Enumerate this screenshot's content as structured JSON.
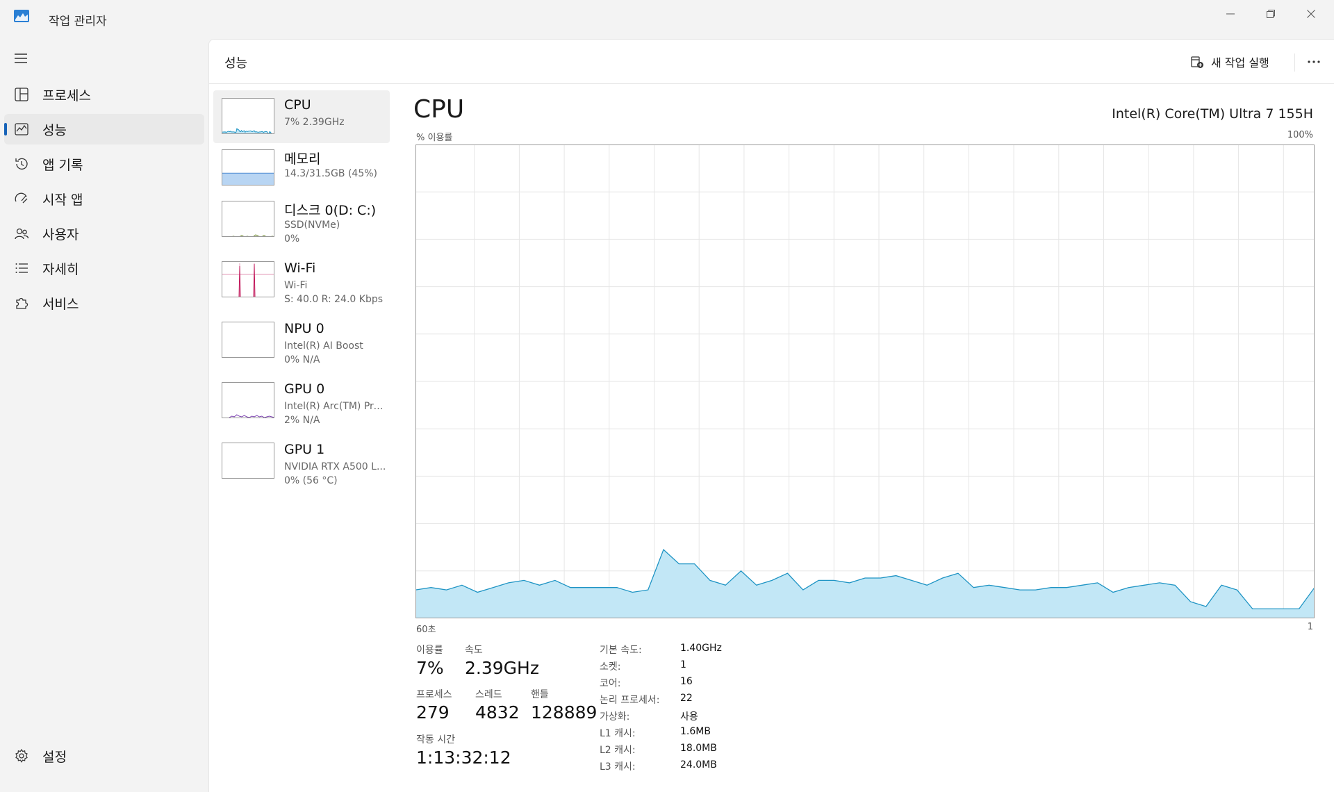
{
  "app": {
    "title": "작업 관리자"
  },
  "sidebar": {
    "items": [
      {
        "label": "프로세스"
      },
      {
        "label": "성능"
      },
      {
        "label": "앱 기록"
      },
      {
        "label": "시작 앱"
      },
      {
        "label": "사용자"
      },
      {
        "label": "자세히"
      },
      {
        "label": "서비스"
      }
    ],
    "settings_label": "설정"
  },
  "header": {
    "page_title": "성능",
    "run_task_label": "새 작업 실행"
  },
  "devices": [
    {
      "name": "CPU",
      "sub1": "7% 2.39GHz",
      "sub2": ""
    },
    {
      "name": "메모리",
      "sub1": "14.3/31.5GB (45%)",
      "sub2": ""
    },
    {
      "name": "디스크 0(D: C:)",
      "sub1": "SSD(NVMe)",
      "sub2": "0%"
    },
    {
      "name": "Wi-Fi",
      "sub1": "Wi-Fi",
      "sub2": "S: 40.0 R: 24.0 Kbps"
    },
    {
      "name": "NPU 0",
      "sub1": "Intel(R) AI Boost",
      "sub2": "0% N/A"
    },
    {
      "name": "GPU 0",
      "sub1": "Intel(R) Arc(TM) Pro...",
      "sub2": "2% N/A"
    },
    {
      "name": "GPU 1",
      "sub1": "NVIDIA RTX A500 L...",
      "sub2": "0% (56 °C)"
    }
  ],
  "detail": {
    "title": "CPU",
    "model": "Intel(R) Core(TM) Ultra 7 155H",
    "axis_top_left": "% 이용률",
    "axis_top_right": "100%",
    "axis_bottom_left": "60초",
    "axis_bottom_right": "1"
  },
  "stats": {
    "utilization_label": "이용률",
    "utilization": "7%",
    "speed_label": "속도",
    "speed": "2.39GHz",
    "processes_label": "프로세스",
    "processes": "279",
    "threads_label": "스레드",
    "threads": "4832",
    "handles_label": "핸들",
    "handles": "128889",
    "uptime_label": "작동 시간",
    "uptime": "1:13:32:12"
  },
  "specs": [
    {
      "label": "기본 속도:",
      "value": "1.40GHz"
    },
    {
      "label": "소켓:",
      "value": "1"
    },
    {
      "label": "코어:",
      "value": "16"
    },
    {
      "label": "논리 프로세서:",
      "value": "22"
    },
    {
      "label": "가상화:",
      "value": "사용"
    },
    {
      "label": "L1 캐시:",
      "value": "1.6MB"
    },
    {
      "label": "L2 캐시:",
      "value": "18.0MB"
    },
    {
      "label": "L3 캐시:",
      "value": "24.0MB"
    }
  ],
  "colors": {
    "cpu_line": "#1e94c4",
    "cpu_fill": "#c2e7f6",
    "memory_fill": "#b8d5f3",
    "wifi_line": "#c2185b",
    "gpu_line": "#7b3fb0",
    "accent": "#1763b8",
    "grid": "#e6e6e6"
  },
  "chart_data": {
    "type": "area",
    "title": "CPU",
    "ylabel": "% 이용률",
    "xlabel": "",
    "ylim": [
      0,
      100
    ],
    "x_range_label": [
      "60초",
      "1"
    ],
    "series": [
      {
        "values": [
          6,
          6.5,
          6,
          7,
          5.5,
          6.5,
          7.5,
          8,
          7,
          8,
          6.5,
          6.5,
          6.5,
          6.5,
          5.5,
          6,
          14.5,
          11.5,
          11.5,
          8,
          7,
          10,
          7,
          8,
          9.5,
          6,
          8,
          8,
          7.5,
          8.5,
          8.5,
          9,
          8,
          7,
          8.5,
          9.5,
          6.5,
          7,
          6.5,
          6,
          6,
          6.5,
          6.5,
          7,
          7.5,
          5.5,
          6.5,
          7,
          7.5,
          7,
          3.5,
          2.5,
          7,
          6,
          2,
          2,
          2,
          2,
          6.5
        ]
      }
    ]
  }
}
